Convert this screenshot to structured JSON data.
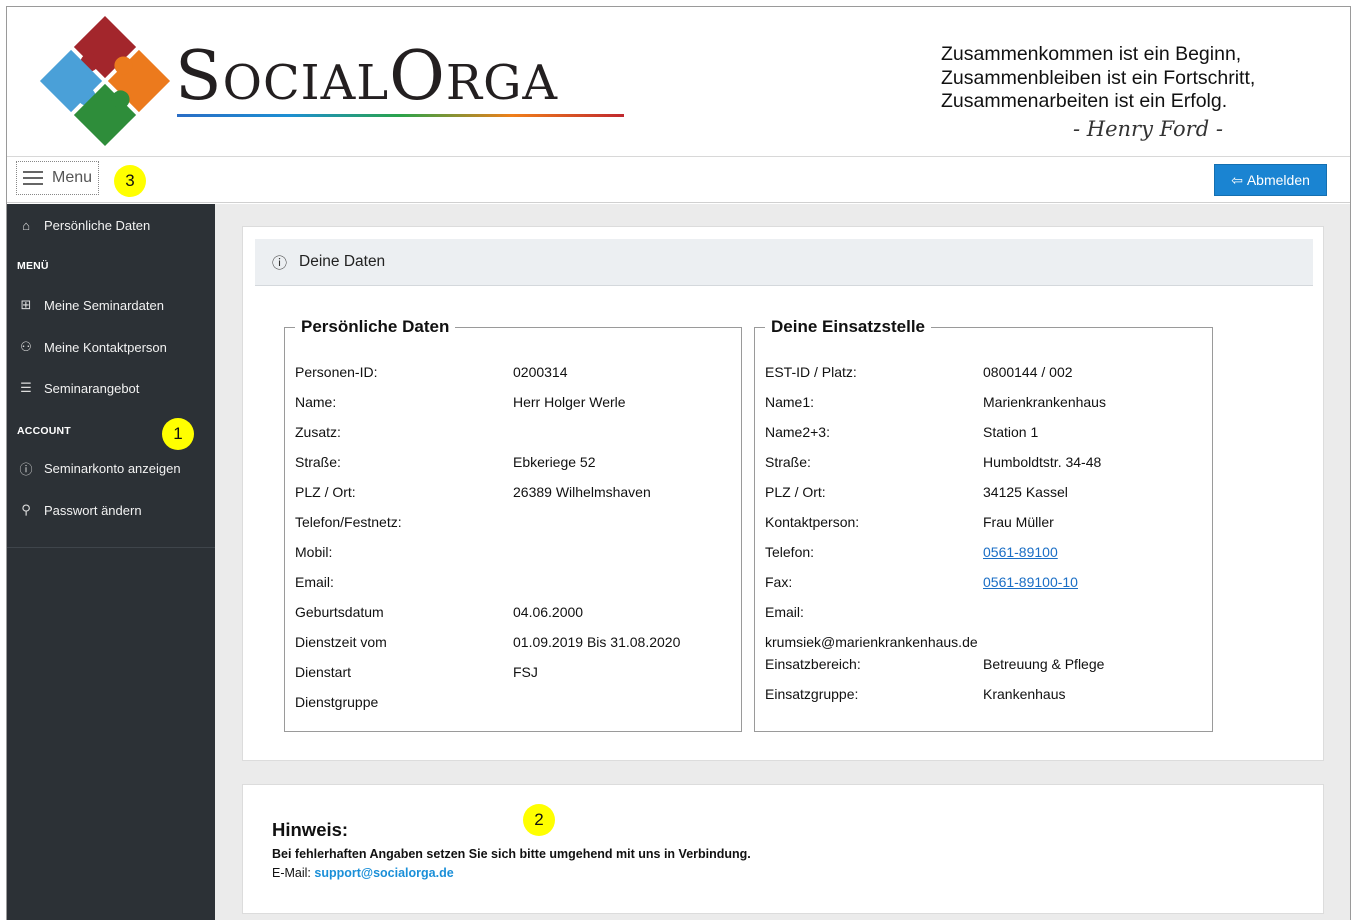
{
  "header": {
    "logo_parts": [
      "S",
      "OCIAL",
      "O",
      "RGA"
    ],
    "quote": [
      "Zusammenkommen ist ein Beginn,",
      "Zusammenbleiben ist ein Fortschritt,",
      "Zusammenarbeiten ist ein Erfolg."
    ],
    "quote_author": "- Henry Ford -"
  },
  "topbar": {
    "menu_label": "Menu",
    "logout_label": "Abmelden"
  },
  "badges": {
    "one": "1",
    "two": "2",
    "three": "3"
  },
  "sidebar": {
    "items": [
      {
        "label": "Persönliche Daten",
        "icon": "home-icon"
      },
      {
        "label": "Meine Seminardaten",
        "icon": "grid-icon"
      },
      {
        "label": "Meine Kontaktperson",
        "icon": "person-icon"
      },
      {
        "label": "Seminarangebot",
        "icon": "list-icon"
      },
      {
        "label": "Seminarkonto anzeigen",
        "icon": "info-icon"
      },
      {
        "label": "Passwort ändern",
        "icon": "key-icon"
      }
    ],
    "section_menu": "MENÜ",
    "section_account": "ACCOUNT"
  },
  "card": {
    "title": "Deine Daten",
    "personal": {
      "legend": "Persönliche Daten",
      "rows": [
        {
          "k": "Personen-ID:",
          "v": "0200314"
        },
        {
          "k": "Name:",
          "v": "Herr Holger Werle"
        },
        {
          "k": "Zusatz:",
          "v": ""
        },
        {
          "k": "Straße:",
          "v": "Ebkeriege 52"
        },
        {
          "k": "PLZ / Ort:",
          "v": "26389 Wilhelmshaven"
        },
        {
          "k": "Telefon/Festnetz:",
          "v": ""
        },
        {
          "k": "Mobil:",
          "v": ""
        },
        {
          "k": "Email:",
          "v": ""
        },
        {
          "k": "Geburtsdatum",
          "v": "04.06.2000"
        },
        {
          "k": "Dienstzeit vom",
          "v": "01.09.2019 Bis 31.08.2020"
        },
        {
          "k": "Dienstart",
          "v": "FSJ"
        },
        {
          "k": "Dienstgruppe",
          "v": ""
        }
      ]
    },
    "station": {
      "legend": "Deine Einsatzstelle",
      "rows": [
        {
          "k": "EST-ID / Platz:",
          "v": "0800144 / 002"
        },
        {
          "k": "Name1:",
          "v": "Marienkrankenhaus"
        },
        {
          "k": "Name2+3:",
          "v": "Station 1"
        },
        {
          "k": "Straße:",
          "v": "Humboldtstr. 34-48"
        },
        {
          "k": "PLZ / Ort:",
          "v": "34125 Kassel"
        },
        {
          "k": "Kontaktperson:",
          "v": "Frau Müller"
        },
        {
          "k": "Telefon:",
          "v": "0561-89100"
        },
        {
          "k": "Fax:",
          "v": "0561-89100-10"
        },
        {
          "k": "Email:",
          "v": ""
        }
      ],
      "email_value": "krumsiek@marienkrankenhaus.de",
      "rows_after": [
        {
          "k": "Einsatzbereich:",
          "v": "Betreuung & Pflege"
        },
        {
          "k": "Einsatzgruppe:",
          "v": "Krankenhaus"
        }
      ]
    }
  },
  "hint": {
    "title": "Hinweis:",
    "text": "Bei fehlerhaften Angaben setzen Sie sich bitte umgehend mit uns in Verbindung.",
    "mail_label": "E-Mail: ",
    "mail": "support@socialorga.de"
  }
}
